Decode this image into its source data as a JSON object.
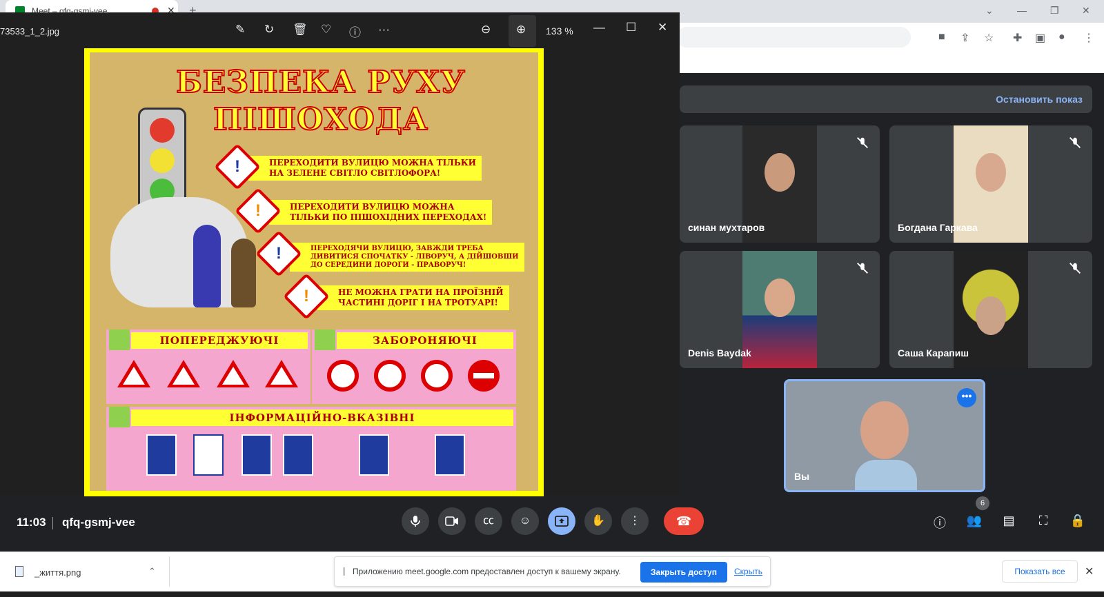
{
  "browser": {
    "tab_title": "Meet – qfq-gsmj-vee",
    "new_tab": "+",
    "tab_close": "✕"
  },
  "viewer": {
    "filename": "73533_1_2.jpg",
    "zoom": "133 %"
  },
  "poster": {
    "title_line1": "БЕЗПЕКА РУХУ",
    "title_line2": "ПІШОХОДА",
    "rules": [
      {
        "line1": "ПЕРЕХОДИТИ ВУЛИЦЮ МОЖНА ТІЛЬКИ",
        "line2": "НА ЗЕЛЕНЕ СВІТЛО СВІТЛОФОРА!"
      },
      {
        "line1": "ПЕРЕХОДИТИ ВУЛИЦЮ МОЖНА",
        "line2": "ТІЛЬКИ ПО ПІШОХІДНИХ ПЕРЕХОДАХ!"
      },
      {
        "line1": "ПЕРЕХОДЯЧИ ВУЛИЦЮ, ЗАВЖДИ ТРЕБА",
        "line2": "ДИВИТИСЯ СПОЧАТКУ - ЛІВОРУЧ, А ДІЙШОВШИ",
        "line3": "ДО СЕРЕДИНИ ДОРОГИ - ПРАВОРУЧ!"
      },
      {
        "line1": "НЕ МОЖНА ГРАТИ НА ПРОЇЗНІЙ",
        "line2": "ЧАСТИНІ ДОРІГ І НА ТРОТУАРІ!"
      }
    ],
    "section_warning": "ПОПЕРЕДЖУЮЧІ",
    "section_prohibit": "ЗАБОРОНЯЮЧІ",
    "section_info": "ІНФОРМАЦІЙНО-ВКАЗІВНІ"
  },
  "meet": {
    "stop_presenting": "Остановить показ",
    "participants": [
      {
        "name": "синан мухтаров"
      },
      {
        "name": "Богдана Гаркава"
      },
      {
        "name": "Denis Baydak"
      },
      {
        "name": "Саша Карапиш"
      }
    ],
    "self_name": "Вы",
    "time": "11:03",
    "meeting_code": "qfq-gsmj-vee",
    "participant_count": "6"
  },
  "shelf": {
    "download_file": "_життя.png",
    "share_message": "Приложению meet.google.com предоставлен доступ к вашему экрану.",
    "stop_sharing": "Закрыть доступ",
    "hide": "Скрыть",
    "show_all": "Показать все"
  },
  "colors": {
    "accent_blue": "#1a73e8",
    "meet_bg": "#202124",
    "hangup_red": "#ea4335",
    "poster_yellow": "#ffff00"
  }
}
